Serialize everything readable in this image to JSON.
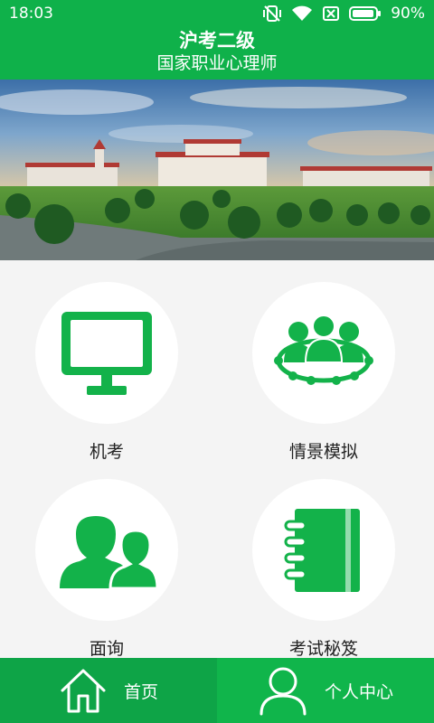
{
  "status": {
    "time": "18:03",
    "battery": "90%",
    "icons": [
      "vibrate-icon",
      "wifi-icon",
      "sim-error-icon",
      "battery-icon"
    ]
  },
  "header": {
    "title": "沪考二级",
    "subtitle": "国家职业心理师"
  },
  "banner": {
    "image": "campus-photo"
  },
  "menu": {
    "items": [
      {
        "label": "机考",
        "icon": "monitor-icon"
      },
      {
        "label": "情景模拟",
        "icon": "group-network-icon"
      },
      {
        "label": "面询",
        "icon": "users-icon"
      },
      {
        "label": "考试秘笈",
        "icon": "notebook-icon"
      }
    ]
  },
  "tabbar": {
    "home": {
      "label": "首页",
      "icon": "home-icon"
    },
    "profile": {
      "label": "个人中心",
      "icon": "person-icon"
    }
  },
  "colors": {
    "primary": "#0fb14a",
    "tab_active": "#0ea447",
    "icon": "#13b24a"
  }
}
